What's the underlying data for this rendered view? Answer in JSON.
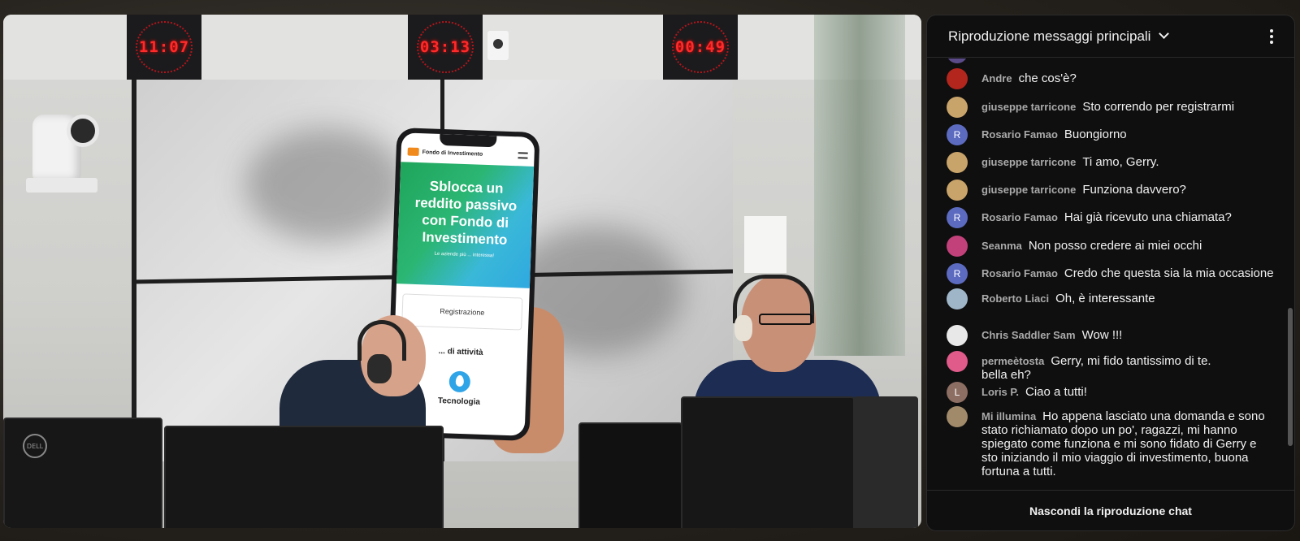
{
  "video": {
    "clocks": [
      "11:07",
      "03:13",
      "00:49"
    ],
    "phone": {
      "brand": "Fondo di Investimento",
      "headline": "Sblocca un reddito passivo con Fondo di Investimento",
      "subtext": "Le aziende più ... interessa!",
      "register_label": "Registrazione",
      "sector_label": "... di attività",
      "technology_label": "Tecnologia"
    },
    "monitor_brand": "DELL"
  },
  "chat": {
    "title": "Riproduzione messaggi principali",
    "hide_replay_label": "Nascondi la riproduzione chat",
    "messages": [
      {
        "author": "Andre",
        "text": "che cos'è?",
        "avatar_color": "#b3261e",
        "avatar_letter": ""
      },
      {
        "author": "giuseppe tarricone",
        "text": "Sto correndo per registrarmi",
        "avatar_color": "#c9a46a",
        "avatar_letter": ""
      },
      {
        "author": "Rosario Famao",
        "text": "Buongiorno",
        "avatar_color": "#5c6bc0",
        "avatar_letter": "R"
      },
      {
        "author": "giuseppe tarricone",
        "text": "Ti amo, Gerry.",
        "avatar_color": "#c9a46a",
        "avatar_letter": ""
      },
      {
        "author": "giuseppe tarricone",
        "text": "Funziona davvero?",
        "avatar_color": "#c9a46a",
        "avatar_letter": ""
      },
      {
        "author": "Rosario Famao",
        "text": "Hai già ricevuto una chiamata?",
        "avatar_color": "#5c6bc0",
        "avatar_letter": "R"
      },
      {
        "author": "Seanma",
        "text": "Non posso credere ai miei occhi",
        "avatar_color": "#c2417a",
        "avatar_letter": ""
      },
      {
        "author": "Rosario Famao",
        "text": "Credo che questa sia la mia occasione",
        "avatar_color": "#5c6bc0",
        "avatar_letter": "R"
      },
      {
        "author": "Roberto Liaci",
        "text": "Oh, è interessante",
        "avatar_color": "#9fb6c8",
        "avatar_letter": ""
      },
      {
        "author": "Chris Saddler Sam",
        "text": "Wow !!!",
        "avatar_color": "#e8e8e8",
        "avatar_letter": ""
      },
      {
        "author": "permeètosta",
        "text": "Gerry, mi fido tantissimo di te. bella eh?",
        "avatar_color": "#e05a8a",
        "avatar_letter": ""
      },
      {
        "author": "Loris P.",
        "text": "Ciao a tutti!",
        "avatar_color": "#8d6e63",
        "avatar_letter": "L"
      },
      {
        "author": "Mi illumina",
        "text": "Ho appena lasciato una domanda e sono stato richiamato dopo un po', ragazzi, mi hanno spiegato come funziona e mi sono fidato di Gerry e sto iniziando il mio viaggio di investimento, buona fortuna a tutti.",
        "avatar_color": "#a08a6a",
        "avatar_letter": ""
      }
    ]
  }
}
